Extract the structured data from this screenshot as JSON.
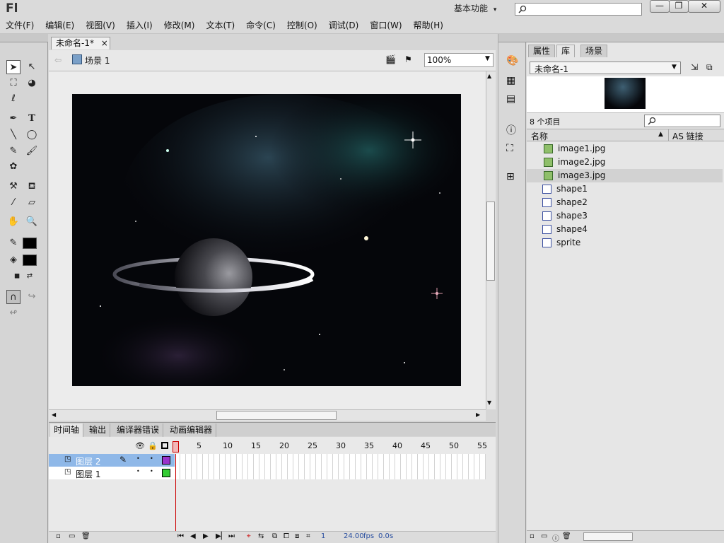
{
  "app": {
    "logo": "Fl",
    "workspace": "基本功能",
    "workspace_arrow": "▾"
  },
  "window_controls": {
    "minimize": "—",
    "restore": "❐",
    "close": "✕"
  },
  "menu": [
    "文件(F)",
    "编辑(E)",
    "视图(V)",
    "插入(I)",
    "修改(M)",
    "文本(T)",
    "命令(C)",
    "控制(O)",
    "调试(D)",
    "窗口(W)",
    "帮助(H)"
  ],
  "document": {
    "tab": "未命名-1*",
    "tab_close": "×",
    "scene": "场景 1",
    "zoom": "100%"
  },
  "timeline": {
    "tabs": [
      "时间轴",
      "输出",
      "编译器错误",
      "动画编辑器"
    ],
    "ruler": [
      "1",
      "5",
      "10",
      "15",
      "20",
      "25",
      "30",
      "35",
      "40",
      "45",
      "50",
      "55"
    ],
    "layers": [
      {
        "name": "图层 2",
        "selected": true,
        "color": "#9933cc"
      },
      {
        "name": "图层 1",
        "selected": false,
        "color": "#33cc33"
      }
    ],
    "status": {
      "frame": "1",
      "fps": "24.00",
      "fps_unit": "fps",
      "time": "0.0",
      "time_unit": "s"
    }
  },
  "panel": {
    "tabs": [
      "属性",
      "库",
      "场景"
    ],
    "active_tab": "库",
    "library_doc": "未命名-1",
    "item_count": "8 个项目",
    "columns": {
      "name": "名称",
      "linkage": "AS 链接"
    },
    "items": [
      {
        "label": "image1.jpg",
        "kind": "bitmap"
      },
      {
        "label": "image2.jpg",
        "kind": "bitmap"
      },
      {
        "label": "image3.jpg",
        "kind": "bitmap"
      },
      {
        "label": "shape1",
        "kind": "graphic"
      },
      {
        "label": "shape2",
        "kind": "graphic"
      },
      {
        "label": "shape3",
        "kind": "graphic"
      },
      {
        "label": "shape4",
        "kind": "graphic"
      },
      {
        "label": "sprite",
        "kind": "movieclip"
      }
    ]
  },
  "colors": {
    "stroke": "#000000",
    "fill": "#000000",
    "playhead": "#cc0000",
    "layer_highlight": "#8fb8e8"
  }
}
